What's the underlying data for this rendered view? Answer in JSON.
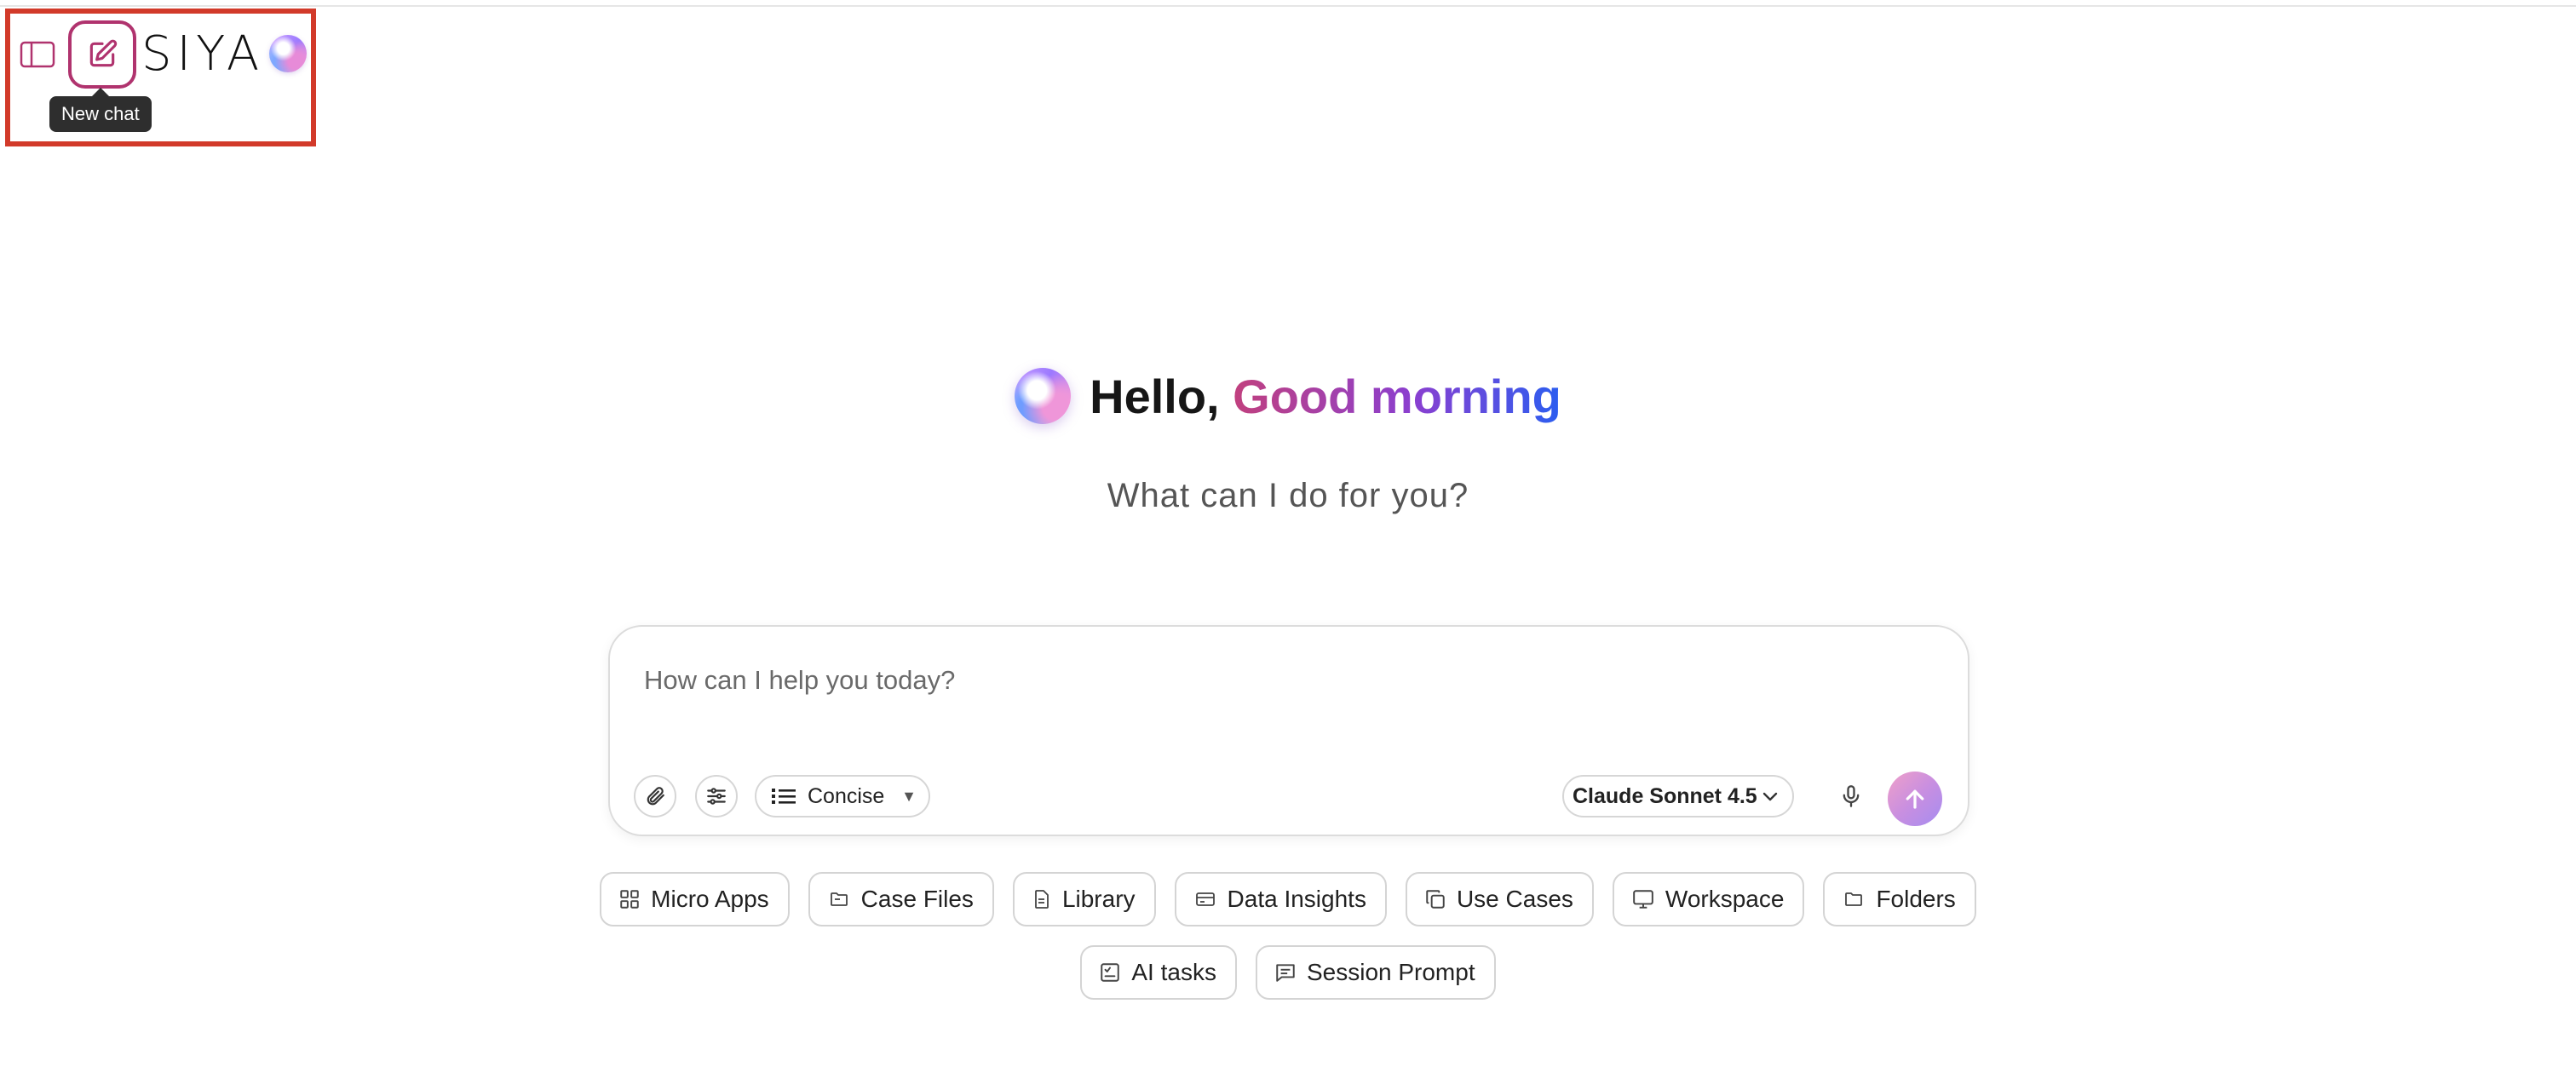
{
  "header": {
    "brand_name": "SIYA",
    "tooltip": "New chat"
  },
  "greeting": {
    "hello": "Hello, ",
    "accent": "Good morning",
    "subtitle": "What can I do for you?"
  },
  "composer": {
    "placeholder": "How can I help you today?",
    "style_label": "Concise",
    "model_label": "Claude Sonnet 4.5"
  },
  "chips": {
    "row1": [
      {
        "label": "Micro Apps",
        "icon": "grid-icon"
      },
      {
        "label": "Case Files",
        "icon": "folder-open-icon"
      },
      {
        "label": "Library",
        "icon": "document-icon"
      },
      {
        "label": "Data Insights",
        "icon": "card-icon"
      },
      {
        "label": "Use Cases",
        "icon": "copy-icon"
      },
      {
        "label": "Workspace",
        "icon": "monitor-icon"
      },
      {
        "label": "Folders",
        "icon": "folder-icon"
      }
    ],
    "row2": [
      {
        "label": "AI tasks",
        "icon": "checklist-icon"
      },
      {
        "label": "Session Prompt",
        "icon": "message-icon"
      }
    ]
  },
  "colors": {
    "brand_pink": "#b0336e",
    "highlight_red": "#d23a2a",
    "accent_gradient_start": "#c1407e",
    "accent_gradient_end": "#2b5ef0"
  }
}
